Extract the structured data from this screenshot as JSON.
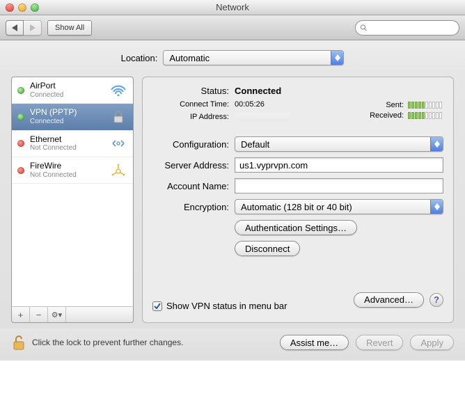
{
  "window": {
    "title": "Network"
  },
  "toolbar": {
    "show_all": "Show All",
    "search_placeholder": ""
  },
  "location": {
    "label": "Location:",
    "value": "Automatic"
  },
  "sidebar": {
    "items": [
      {
        "name": "AirPort",
        "sub": "Connected",
        "status": "green",
        "icon": "wifi"
      },
      {
        "name": "VPN (PPTP)",
        "sub": "Connected",
        "status": "green",
        "icon": "lock"
      },
      {
        "name": "Ethernet",
        "sub": "Not Connected",
        "status": "red",
        "icon": "ethernet"
      },
      {
        "name": "FireWire",
        "sub": "Not Connected",
        "status": "red",
        "icon": "firewire"
      }
    ],
    "controls": {
      "add": "+",
      "remove": "−",
      "action": "⚙︎▾"
    }
  },
  "detail": {
    "status_label": "Status:",
    "status_value": "Connected",
    "connect_time_label": "Connect Time:",
    "connect_time_value": "00:05:26",
    "ip_label": "IP Address:",
    "ip_value": "",
    "sent_label": "Sent:",
    "sent_bars_filled": 5,
    "sent_bars_total": 10,
    "recv_label": "Received:",
    "recv_bars_filled": 5,
    "recv_bars_total": 10,
    "config_label": "Configuration:",
    "config_value": "Default",
    "server_label": "Server Address:",
    "server_value": "us1.vyprvpn.com",
    "account_label": "Account Name:",
    "account_value": "",
    "enc_label": "Encryption:",
    "enc_value": "Automatic (128 bit or 40 bit)",
    "auth_btn": "Authentication Settings…",
    "disconnect_btn": "Disconnect",
    "show_vpn": "Show VPN status in menu bar",
    "show_vpn_checked": true,
    "advanced_btn": "Advanced…"
  },
  "footer": {
    "lock_text": "Click the lock to prevent further changes.",
    "assist": "Assist me…",
    "revert": "Revert",
    "apply": "Apply"
  }
}
